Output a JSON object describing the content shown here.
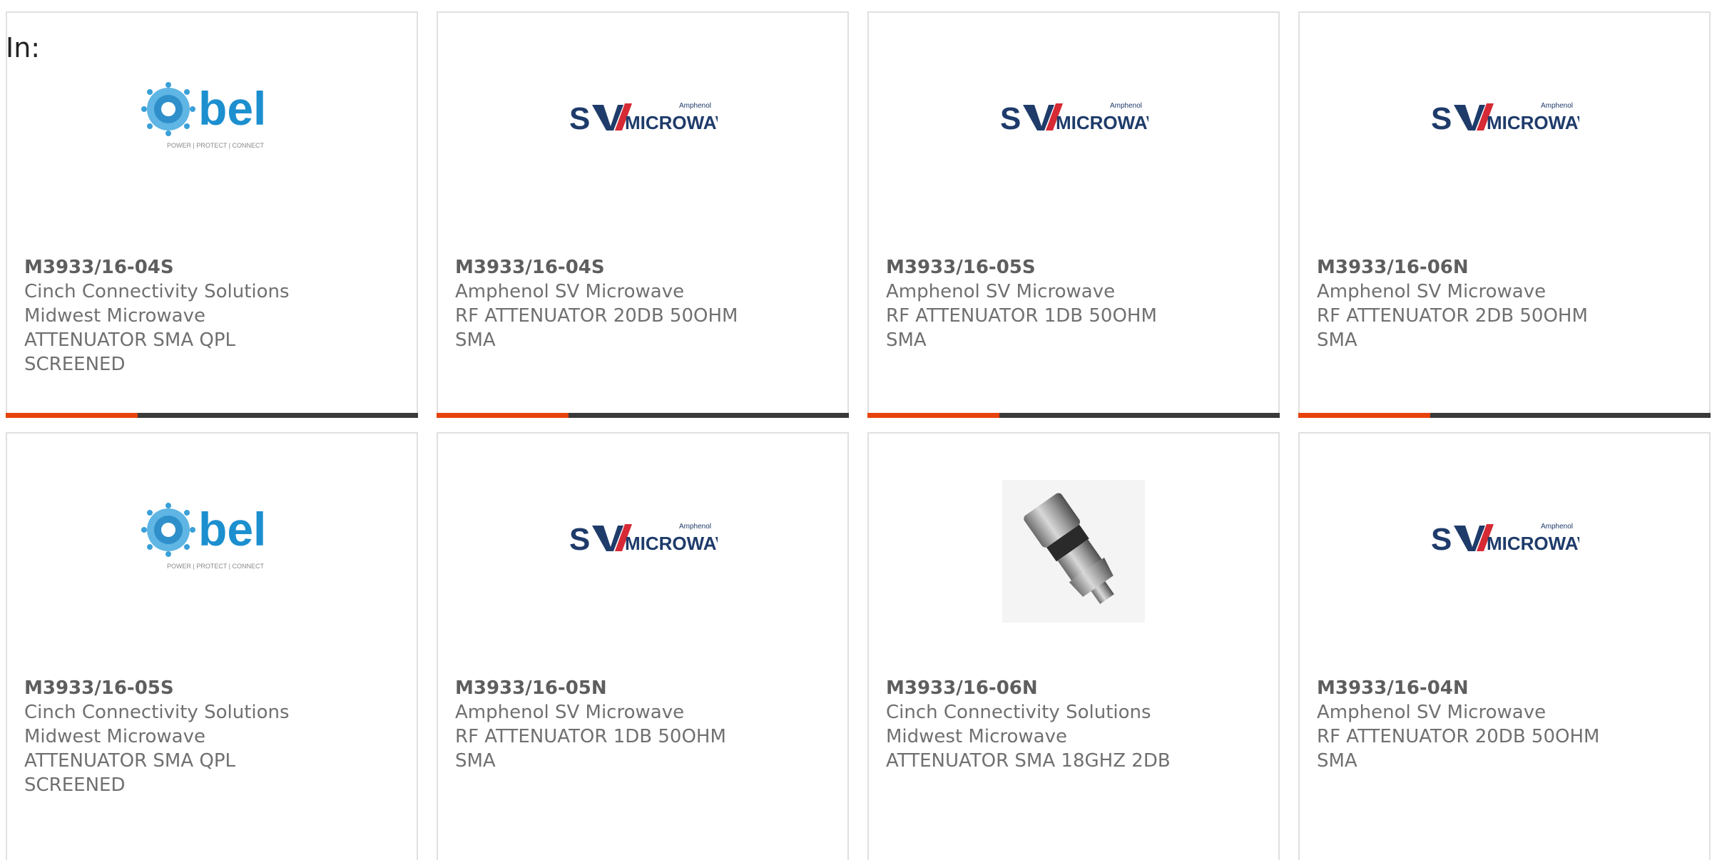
{
  "header": {
    "label": "In:"
  },
  "colors": {
    "accent": "#e8420c",
    "bar": "#3a3a3a",
    "bel_blue": "#1c8fcf",
    "sv_navy": "#1e3b6a",
    "sv_red": "#d62a35"
  },
  "products": [
    {
      "part": "M3933/16-04S",
      "manufacturer": "Cinch Connectivity Solutions",
      "lines": [
        "Midwest Microwave",
        "ATTENUATOR SMA QPL",
        "SCREENED"
      ],
      "logo": "bel-logo",
      "logo_tagline": "POWER | PROTECT | CONNECT",
      "progress": 0.32
    },
    {
      "part": "M3933/16-04S",
      "manufacturer": "Amphenol SV Microwave",
      "lines": [
        "RF ATTENUATOR 20DB 50OHM",
        "SMA"
      ],
      "logo": "sv-microwave-logo",
      "logo_brand": "Amphenol",
      "logo_text": "MICROWAVE",
      "progress": 0.32
    },
    {
      "part": "M3933/16-05S",
      "manufacturer": "Amphenol SV Microwave",
      "lines": [
        "RF ATTENUATOR 1DB 50OHM",
        "SMA"
      ],
      "logo": "sv-microwave-logo",
      "logo_brand": "Amphenol",
      "logo_text": "MICROWAVE",
      "progress": 0.32
    },
    {
      "part": "M3933/16-06N",
      "manufacturer": "Amphenol SV Microwave",
      "lines": [
        "RF ATTENUATOR 2DB 50OHM",
        "SMA"
      ],
      "logo": "sv-microwave-logo",
      "logo_brand": "Amphenol",
      "logo_text": "MICROWAVE",
      "progress": 0.32
    },
    {
      "part": "M3933/16-05S",
      "manufacturer": "Cinch Connectivity Solutions",
      "lines": [
        "Midwest Microwave",
        "ATTENUATOR SMA QPL",
        "SCREENED"
      ],
      "logo": "bel-logo",
      "logo_tagline": "POWER | PROTECT | CONNECT"
    },
    {
      "part": "M3933/16-05N",
      "manufacturer": "Amphenol SV Microwave",
      "lines": [
        "RF ATTENUATOR 1DB 50OHM",
        "SMA"
      ],
      "logo": "sv-microwave-logo",
      "logo_brand": "Amphenol",
      "logo_text": "MICROWAVE"
    },
    {
      "part": "M3933/16-06N",
      "manufacturer": "Cinch Connectivity Solutions",
      "lines": [
        "Midwest Microwave",
        "ATTENUATOR SMA 18GHZ 2DB"
      ],
      "logo": "attenuator-photo"
    },
    {
      "part": "M3933/16-04N",
      "manufacturer": "Amphenol SV Microwave",
      "lines": [
        "RF ATTENUATOR 20DB 50OHM",
        "SMA"
      ],
      "logo": "sv-microwave-logo",
      "logo_brand": "Amphenol",
      "logo_text": "MICROWAVE"
    }
  ]
}
